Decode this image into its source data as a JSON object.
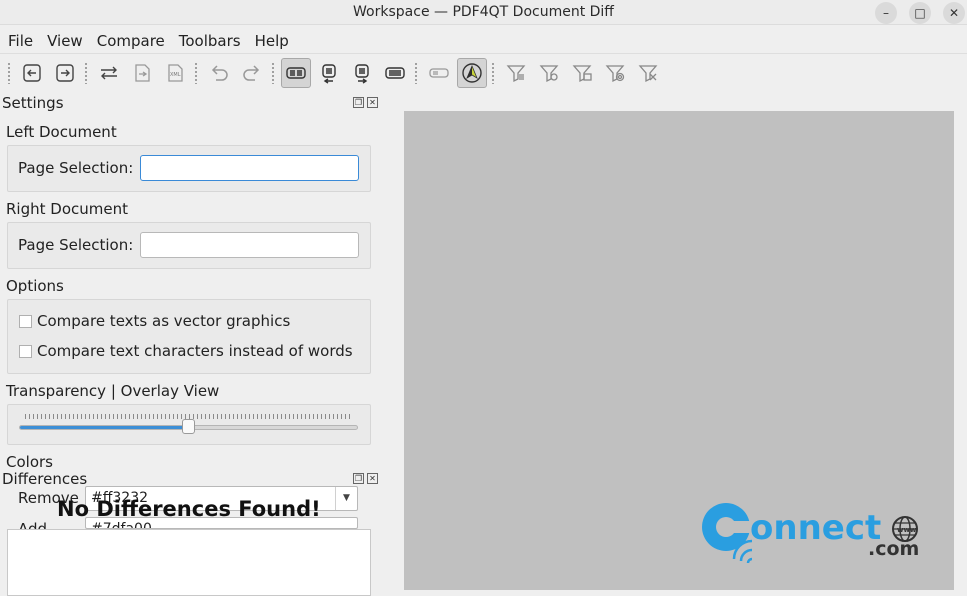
{
  "window": {
    "title": "Workspace — PDF4QT Document Diff"
  },
  "menu": [
    "File",
    "View",
    "Compare",
    "Toolbars",
    "Help"
  ],
  "toolbar": {
    "buttons": [
      "open-left-icon",
      "open-right-icon",
      "swap-icon",
      "export-icon",
      "xml-icon",
      "undo-icon",
      "redo-icon",
      "view-different-icon",
      "view-left-icon",
      "view-right-icon",
      "view-overlay-icon",
      "toggle-icon",
      "auto-icon",
      "filter-text-icon",
      "filter-vector-icon",
      "filter-image-icon",
      "filter-shading-icon",
      "filter-reorder-icon"
    ]
  },
  "settings": {
    "title": "Settings",
    "left_document": "Left Document",
    "right_document": "Right Document",
    "page_selection_label": "Page Selection:",
    "left_page_selection": "",
    "right_page_selection": "",
    "options_label": "Options",
    "option_vector": "Compare texts as vector graphics",
    "option_chars": "Compare text characters instead of words",
    "transparency_label": "Transparency | Overlay View",
    "transparency_value": 0.5,
    "colors_label": "Colors",
    "remove_label": "Remove",
    "remove_color": "#ff3232",
    "add_label": "Add",
    "add_color": "#7dfa00"
  },
  "differences": {
    "title": "Differences",
    "message": "No Differences Found!"
  },
  "watermark": {
    "text1": "onnect",
    "text2": ".com",
    "www": "www"
  },
  "colors": {
    "accent": "#3d8fd6",
    "viewer_bg": "#c0c0c0",
    "logo_blue": "#2a9ee0"
  }
}
